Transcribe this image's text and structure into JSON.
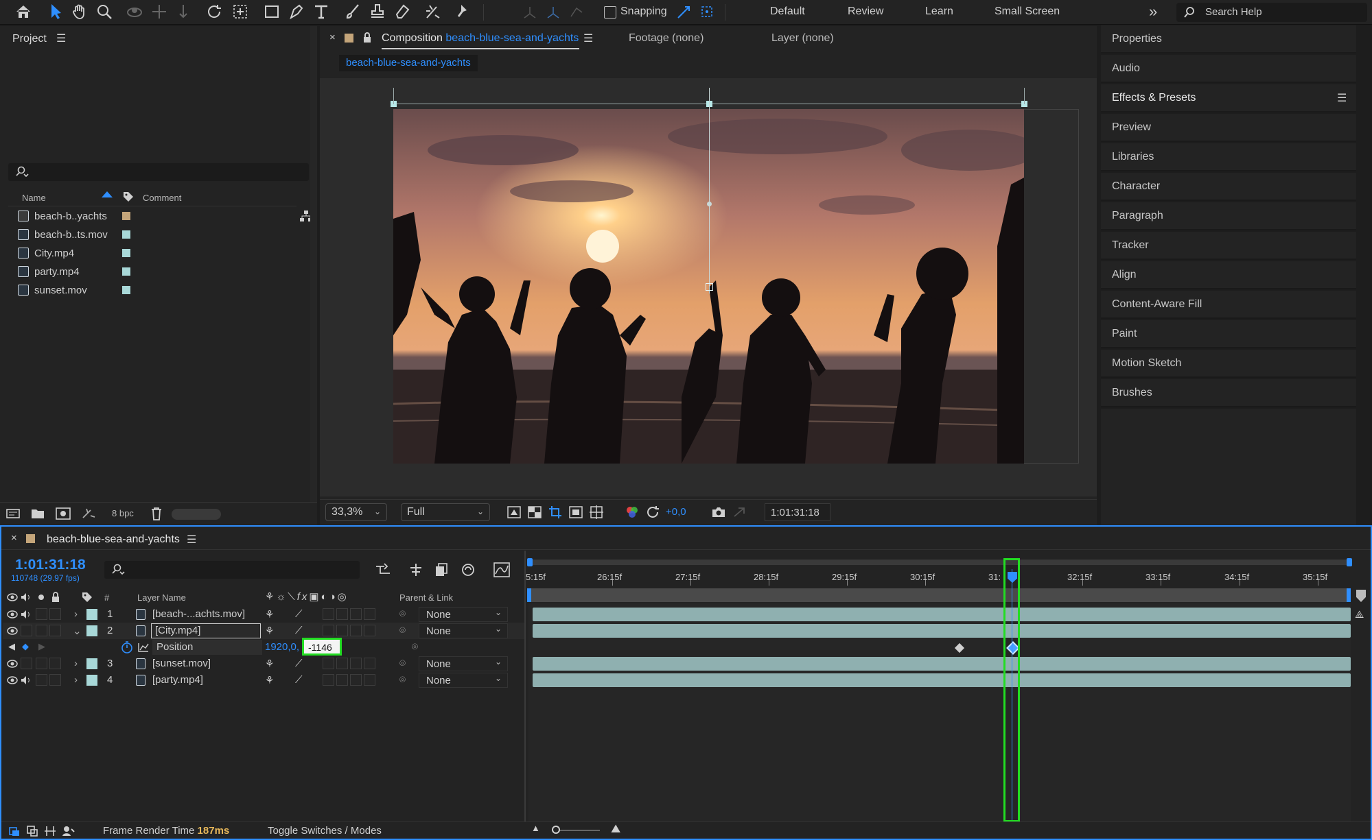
{
  "toolbar": {
    "snapping_label": "Snapping",
    "workspaces": [
      "Default",
      "Review",
      "Learn",
      "Small Screen"
    ],
    "search_placeholder": "Search Help"
  },
  "project": {
    "title": "Project",
    "columns": {
      "name": "Name",
      "comment": "Comment"
    },
    "items": [
      {
        "name": "beach-b..yachts",
        "color": "#c4a57a",
        "kind": "composition"
      },
      {
        "name": "beach-b..ts.mov",
        "color": "#a8d8d8",
        "kind": "footage"
      },
      {
        "name": "City.mp4",
        "color": "#a8d8d8",
        "kind": "footage"
      },
      {
        "name": "party.mp4",
        "color": "#a8d8d8",
        "kind": "footage"
      },
      {
        "name": "sunset.mov",
        "color": "#a8d8d8",
        "kind": "footage"
      }
    ],
    "bpc": "8 bpc"
  },
  "viewer": {
    "comp_tab_prefix": "Composition",
    "comp_name": "beach-blue-sea-and-yachts",
    "footage_tab": "Footage (none)",
    "layer_tab": "Layer (none)",
    "breadcrumb": "beach-blue-sea-and-yachts",
    "zoom": "33,3%",
    "resolution": "Full",
    "exposure": "+0,0",
    "timecode": "1:01:31:18"
  },
  "panels": [
    "Properties",
    "Audio",
    "Effects & Presets",
    "Preview",
    "Libraries",
    "Character",
    "Paragraph",
    "Tracker",
    "Align",
    "Content-Aware Fill",
    "Paint",
    "Motion Sketch",
    "Brushes"
  ],
  "timeline": {
    "comp_name": "beach-blue-sea-and-yachts",
    "current_time": "1:01:31:18",
    "frame_info": "110748 (29.97 fps)",
    "headers": {
      "layer_name": "Layer Name",
      "number": "#",
      "parent": "Parent & Link"
    },
    "layers": [
      {
        "num": "1",
        "name": "[beach-...achts.mov]",
        "parent": "None"
      },
      {
        "num": "2",
        "name": "[City.mp4]",
        "parent": "None"
      },
      {
        "num": "3",
        "name": "[sunset.mov]",
        "parent": "None"
      },
      {
        "num": "4",
        "name": "[party.mp4]",
        "parent": "None"
      }
    ],
    "property": {
      "name": "Position",
      "x": "1920,0,",
      "y": "-1146"
    },
    "ruler_ticks": [
      "5:15f",
      "26:15f",
      "27:15f",
      "28:15f",
      "29:15f",
      "30:15f",
      "31:",
      "32:15f",
      "33:15f",
      "34:15f",
      "35:15f"
    ],
    "footer": {
      "render_label": "Frame Render Time",
      "render_value": "187ms",
      "toggle": "Toggle Switches / Modes"
    }
  },
  "colors": {
    "accent": "#2f8fff",
    "highlight": "#22dd22",
    "layer_bar": "#8fb0b0"
  }
}
